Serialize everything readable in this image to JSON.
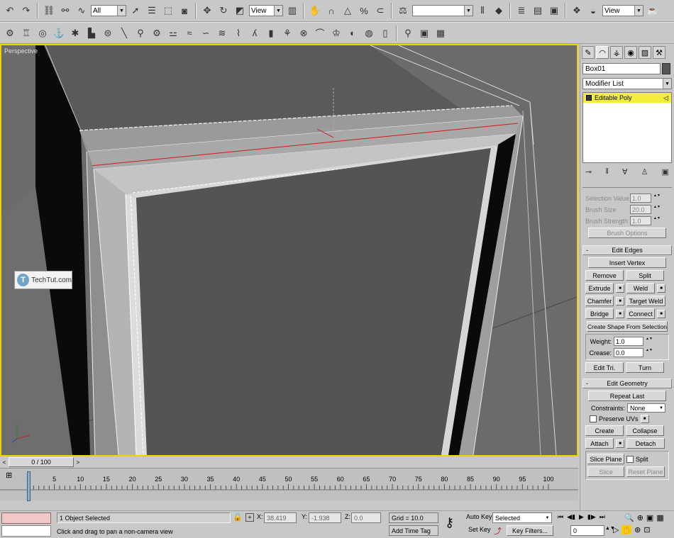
{
  "main_toolbar": {
    "selection_filter": "All",
    "ref_coord": "View",
    "named_selection": "",
    "render_view": "View",
    "icons": [
      "undo-icon",
      "redo-icon",
      "link-icon",
      "unlink-icon",
      "bind-spacewarp-icon",
      "select-icon",
      "select-by-name-icon",
      "rect-region-icon",
      "window-crossing-icon",
      "move-icon",
      "rotate-icon",
      "scale-icon",
      "pivot-icon",
      "manipulate-icon",
      "snap-3d-icon",
      "angle-snap-icon",
      "percent-snap-icon",
      "spinner-snap-icon",
      "edit-named-sel-icon",
      "mirror-icon",
      "align-icon",
      "layer-manager-icon",
      "curve-editor-icon",
      "schematic-icon",
      "material-editor-icon",
      "render-setup-icon",
      "quick-render-icon"
    ]
  },
  "tab_toolbar": {
    "icons": [
      "tab-sphere-icon",
      "tab-teapot-icon",
      "tab-torus-icon",
      "tab-light-icon",
      "tab-camera-icon",
      "tab-box-icon",
      "tab-cylinder-icon",
      "tab-line-icon",
      "tab-key-icon",
      "tab-gear-icon",
      "tab-bone-icon",
      "tab-wind-icon",
      "tab-wave-icon",
      "tab-ripple-icon",
      "tab-path-icon",
      "tab-fx-icon",
      "tab-geo-icon",
      "tab-rotate-icon",
      "tab-tube-icon",
      "tab-shirt-icon",
      "tab-pyramid-icon",
      "tab-sphere2-icon",
      "tab-pane-icon",
      "tab-magnifier-icon",
      "tab-render-icon",
      "tab-film-icon"
    ]
  },
  "viewport": {
    "label": "Perspective",
    "watermark": "TechTut.com",
    "watermark_logo": "T"
  },
  "command_panel": {
    "tabs": [
      "create-tab",
      "modify-tab",
      "hierarchy-tab",
      "motion-tab",
      "display-tab",
      "utilities-tab"
    ],
    "object_name": "Box01",
    "modifier_list": "Modifier List",
    "stack_item": "Editable Poly",
    "soft_selection": {
      "selection_value_label": "Selection Value",
      "selection_value": "1.0",
      "brush_size_label": "Brush Size",
      "brush_size": "20.0",
      "brush_strength_label": "Brush Strength",
      "brush_strength": "1.0",
      "brush_options": "Brush Options"
    },
    "edit_edges": {
      "title": "Edit Edges",
      "insert_vertex": "Insert Vertex",
      "remove": "Remove",
      "split": "Split",
      "extrude": "Extrude",
      "weld": "Weld",
      "chamfer": "Chamfer",
      "target_weld": "Target Weld",
      "bridge": "Bridge",
      "connect": "Connect",
      "create_shape": "Create Shape From Selection",
      "weight_label": "Weight:",
      "weight": "1.0",
      "crease_label": "Crease:",
      "crease": "0.0",
      "edit_tri": "Edit Tri.",
      "turn": "Turn"
    },
    "edit_geometry": {
      "title": "Edit Geometry",
      "repeat_last": "Repeat Last",
      "constraints_label": "Constraints:",
      "constraints": "None",
      "preserve_uvs": "Preserve UVs",
      "create": "Create",
      "collapse": "Collapse",
      "attach": "Attach",
      "detach": "Detach",
      "slice_plane": "Slice Plane",
      "split": "Split",
      "slice": "Slice",
      "reset_plane": "Reset Plane"
    }
  },
  "timeline": {
    "slider_label": "0 / 100",
    "ticks": [
      "0",
      "5",
      "10",
      "15",
      "20",
      "25",
      "30",
      "35",
      "40",
      "45",
      "50",
      "55",
      "60",
      "65",
      "70",
      "75",
      "80",
      "85",
      "90",
      "95",
      "100"
    ]
  },
  "status_bar": {
    "selection_info": "1 Object Selected",
    "prompt": "Click and drag to pan a non-camera view",
    "x_label": "X:",
    "x_value": "38.419",
    "y_label": "Y:",
    "y_value": "-1.938",
    "z_label": "Z:",
    "z_value": "0.0",
    "grid": "Grid = 10.0",
    "add_time_tag": "Add Time Tag",
    "auto_key": "Auto Key",
    "set_key": "Set Key",
    "key_mode": "Selected",
    "key_filters": "Key Filters...",
    "current_frame": "0"
  },
  "colors": {
    "viewport_border": "#f0d000",
    "stack_highlight": "#f2ee3a",
    "selected_edge": "#cc1a1a"
  }
}
